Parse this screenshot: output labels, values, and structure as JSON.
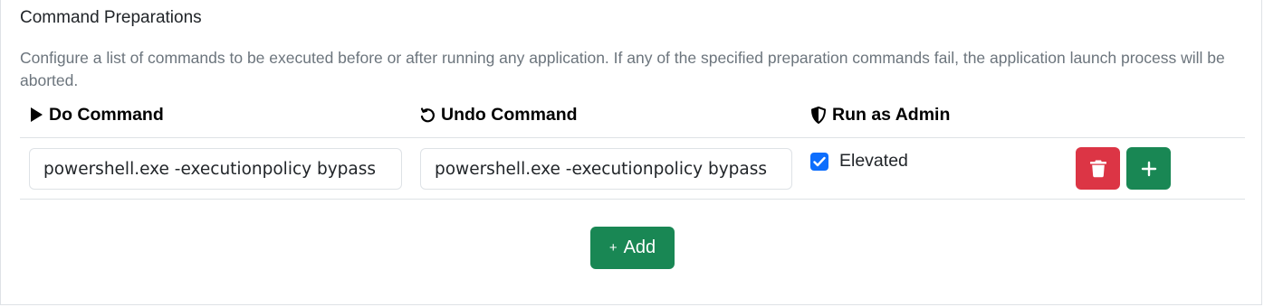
{
  "section": {
    "title": "Command Preparations",
    "description": "Configure a list of commands to be executed before or after running any application. If any of the specified preparation commands fail, the application launch process will be aborted."
  },
  "table": {
    "headers": {
      "do": "Do Command",
      "undo": "Undo Command",
      "admin": "Run as Admin"
    },
    "rows": [
      {
        "do": "powershell.exe -executionpolicy bypass",
        "undo": "powershell.exe -executionpolicy bypass",
        "elevated_label": "Elevated",
        "elevated": true
      }
    ]
  },
  "add_button": {
    "plus": "+",
    "label": "Add"
  },
  "colors": {
    "danger": "#dc3545",
    "success": "#198754",
    "primary": "#0d6efd",
    "muted": "#6c757d"
  }
}
